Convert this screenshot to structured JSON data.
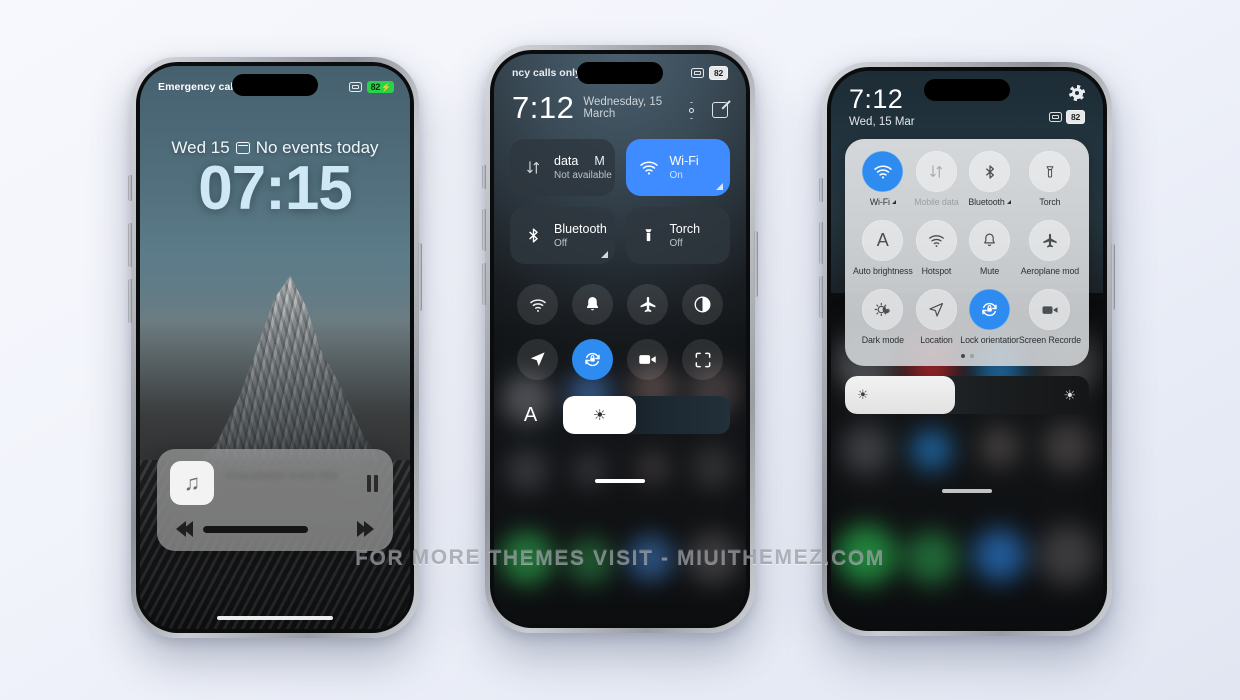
{
  "watermark": "FOR MORE THEMES VISIT - MIUITHEMEZ.COM",
  "colors": {
    "accent": "#3e8cff",
    "accent_light": "#2e8bf0",
    "battery_green": "#2ad24a",
    "page_bg": "#f2f4fb"
  },
  "phone1": {
    "statusbar": {
      "carrier": "Emergency cal",
      "camera_icon": "camera-icon",
      "battery": "82",
      "charging_icon": "bolt-icon"
    },
    "lockscreen": {
      "date": "Wed 15",
      "calendar_icon": "calendar-icon",
      "events": "No events today",
      "clock": "07:15"
    },
    "music": {
      "album_icon": "music-note-icon",
      "title": "Unavailable track title",
      "subtitle": "Unavailable artist name",
      "pause_button": "pause-icon",
      "prev_button": "rewind-icon",
      "next_button": "fast-forward-icon",
      "progress_percent": 73
    },
    "home_indicator": "home-indicator"
  },
  "phone2": {
    "statusbar": {
      "carrier": "ncy calls only",
      "camera_icon": "camera-icon",
      "battery": "82"
    },
    "header": {
      "time": "7:12",
      "date": "Wednesday, 15 March",
      "settings_icon": "settings-hex-icon",
      "edit_icon": "edit-pencil-icon"
    },
    "tiles": [
      {
        "name": "data",
        "name_extra": "M",
        "sub": "Not available",
        "icon": "mobile-data-icon",
        "active": false,
        "expandable": false
      },
      {
        "name": "Wi-Fi",
        "name_extra": "",
        "sub": "On",
        "icon": "wifi-icon",
        "active": true,
        "expandable": true
      },
      {
        "name": "Bluetooth",
        "name_extra": "",
        "sub": "Off",
        "icon": "bluetooth-icon",
        "active": false,
        "expandable": true
      },
      {
        "name": "Torch",
        "name_extra": "",
        "sub": "Off",
        "icon": "torch-icon",
        "active": false,
        "expandable": false
      }
    ],
    "round_buttons": [
      {
        "icon": "hotspot-icon",
        "active": false
      },
      {
        "icon": "bell-icon",
        "active": false
      },
      {
        "icon": "aeroplane-icon",
        "active": false
      },
      {
        "icon": "dark-mode-icon",
        "active": false
      },
      {
        "icon": "location-icon",
        "active": false
      },
      {
        "icon": "lock-orientation-icon",
        "active": true
      },
      {
        "icon": "screen-recorder-icon",
        "active": false
      },
      {
        "icon": "scan-icon",
        "active": false
      }
    ],
    "brightness": {
      "auto_label": "A",
      "sun_icon": "sun-icon",
      "value_percent": 44
    },
    "drag_pill": "drag-handle"
  },
  "phone3": {
    "header": {
      "time": "7:12",
      "date": "Wed, 15 Mar",
      "settings_icon": "gear-icon",
      "camera_icon": "camera-icon",
      "battery": "82"
    },
    "toggles": [
      {
        "label": "Wi-Fi",
        "icon": "wifi-icon",
        "active": true,
        "dim": false,
        "expandable": true
      },
      {
        "label": "Mobile data",
        "icon": "mobile-data-icon",
        "active": false,
        "dim": true,
        "expandable": true
      },
      {
        "label": "Bluetooth",
        "icon": "bluetooth-icon",
        "active": false,
        "dim": false,
        "expandable": true
      },
      {
        "label": "Torch",
        "icon": "torch-icon",
        "active": false,
        "dim": false,
        "expandable": false
      },
      {
        "label": "Auto brightness",
        "icon": "auto-brightness-icon",
        "active": false,
        "dim": false,
        "expandable": false
      },
      {
        "label": "Hotspot",
        "icon": "hotspot-icon",
        "active": false,
        "dim": false,
        "expandable": false
      },
      {
        "label": "Mute",
        "icon": "bell-icon",
        "active": false,
        "dim": false,
        "expandable": false
      },
      {
        "label": "Aeroplane mod",
        "icon": "aeroplane-icon",
        "active": false,
        "dim": false,
        "expandable": false
      },
      {
        "label": "Dark mode",
        "icon": "dark-mode-icon",
        "active": false,
        "dim": false,
        "expandable": false
      },
      {
        "label": "Location",
        "icon": "location-icon",
        "active": false,
        "dim": false,
        "expandable": false
      },
      {
        "label": "Lock orientatior",
        "icon": "lock-orientation-icon",
        "active": true,
        "dim": false,
        "expandable": false
      },
      {
        "label": "Screen Recorde",
        "icon": "screen-recorder-icon",
        "active": false,
        "dim": false,
        "expandable": false
      }
    ],
    "pagination": {
      "current": 1,
      "total": 2
    },
    "brightness": {
      "sun_icon": "sun-icon",
      "value_percent": 45
    },
    "drag_pill": "drag-handle"
  }
}
